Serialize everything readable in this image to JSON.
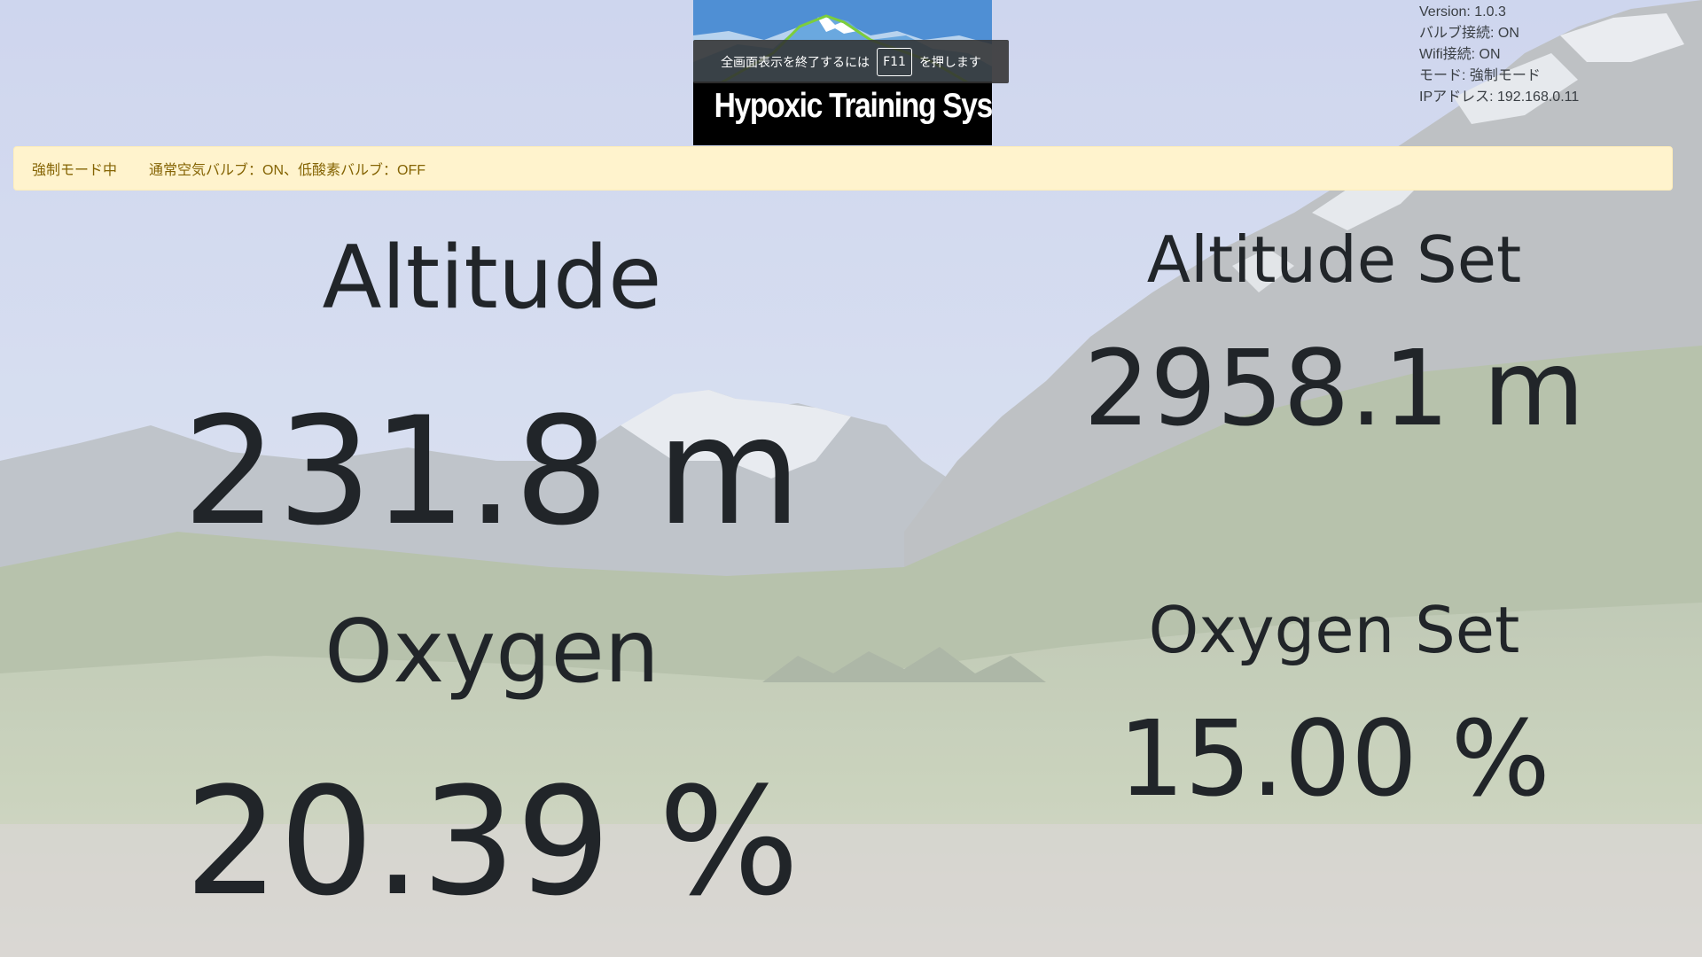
{
  "logo": {
    "text": "Hypoxic Training Systems"
  },
  "fullscreen_notice": {
    "prefix": "全画面表示を終了するには",
    "key": "F11",
    "suffix": "を押します"
  },
  "status_info": {
    "version": "Version: 1.0.3",
    "valve_connection": "バルブ接続: ON",
    "wifi_connection": "Wifi接続: ON",
    "mode": "モード: 強制モード",
    "ip_address": "IPアドレス: 192.168.0.11"
  },
  "alert": {
    "mode_text": "強制モード中",
    "valve_status": "通常空気バルブ：ON、低酸素バルブ：OFF",
    "background_color": "#fff3cd",
    "text_color": "#856404"
  },
  "readings": {
    "altitude": {
      "label": "Altitude",
      "value": "231.8 m"
    },
    "oxygen": {
      "label": "Oxygen",
      "value": "20.39 %"
    },
    "altitude_set": {
      "label": "Altitude Set",
      "value": "2958.1 m"
    },
    "oxygen_set": {
      "label": "Oxygen Set",
      "value": "15.00 %"
    }
  }
}
